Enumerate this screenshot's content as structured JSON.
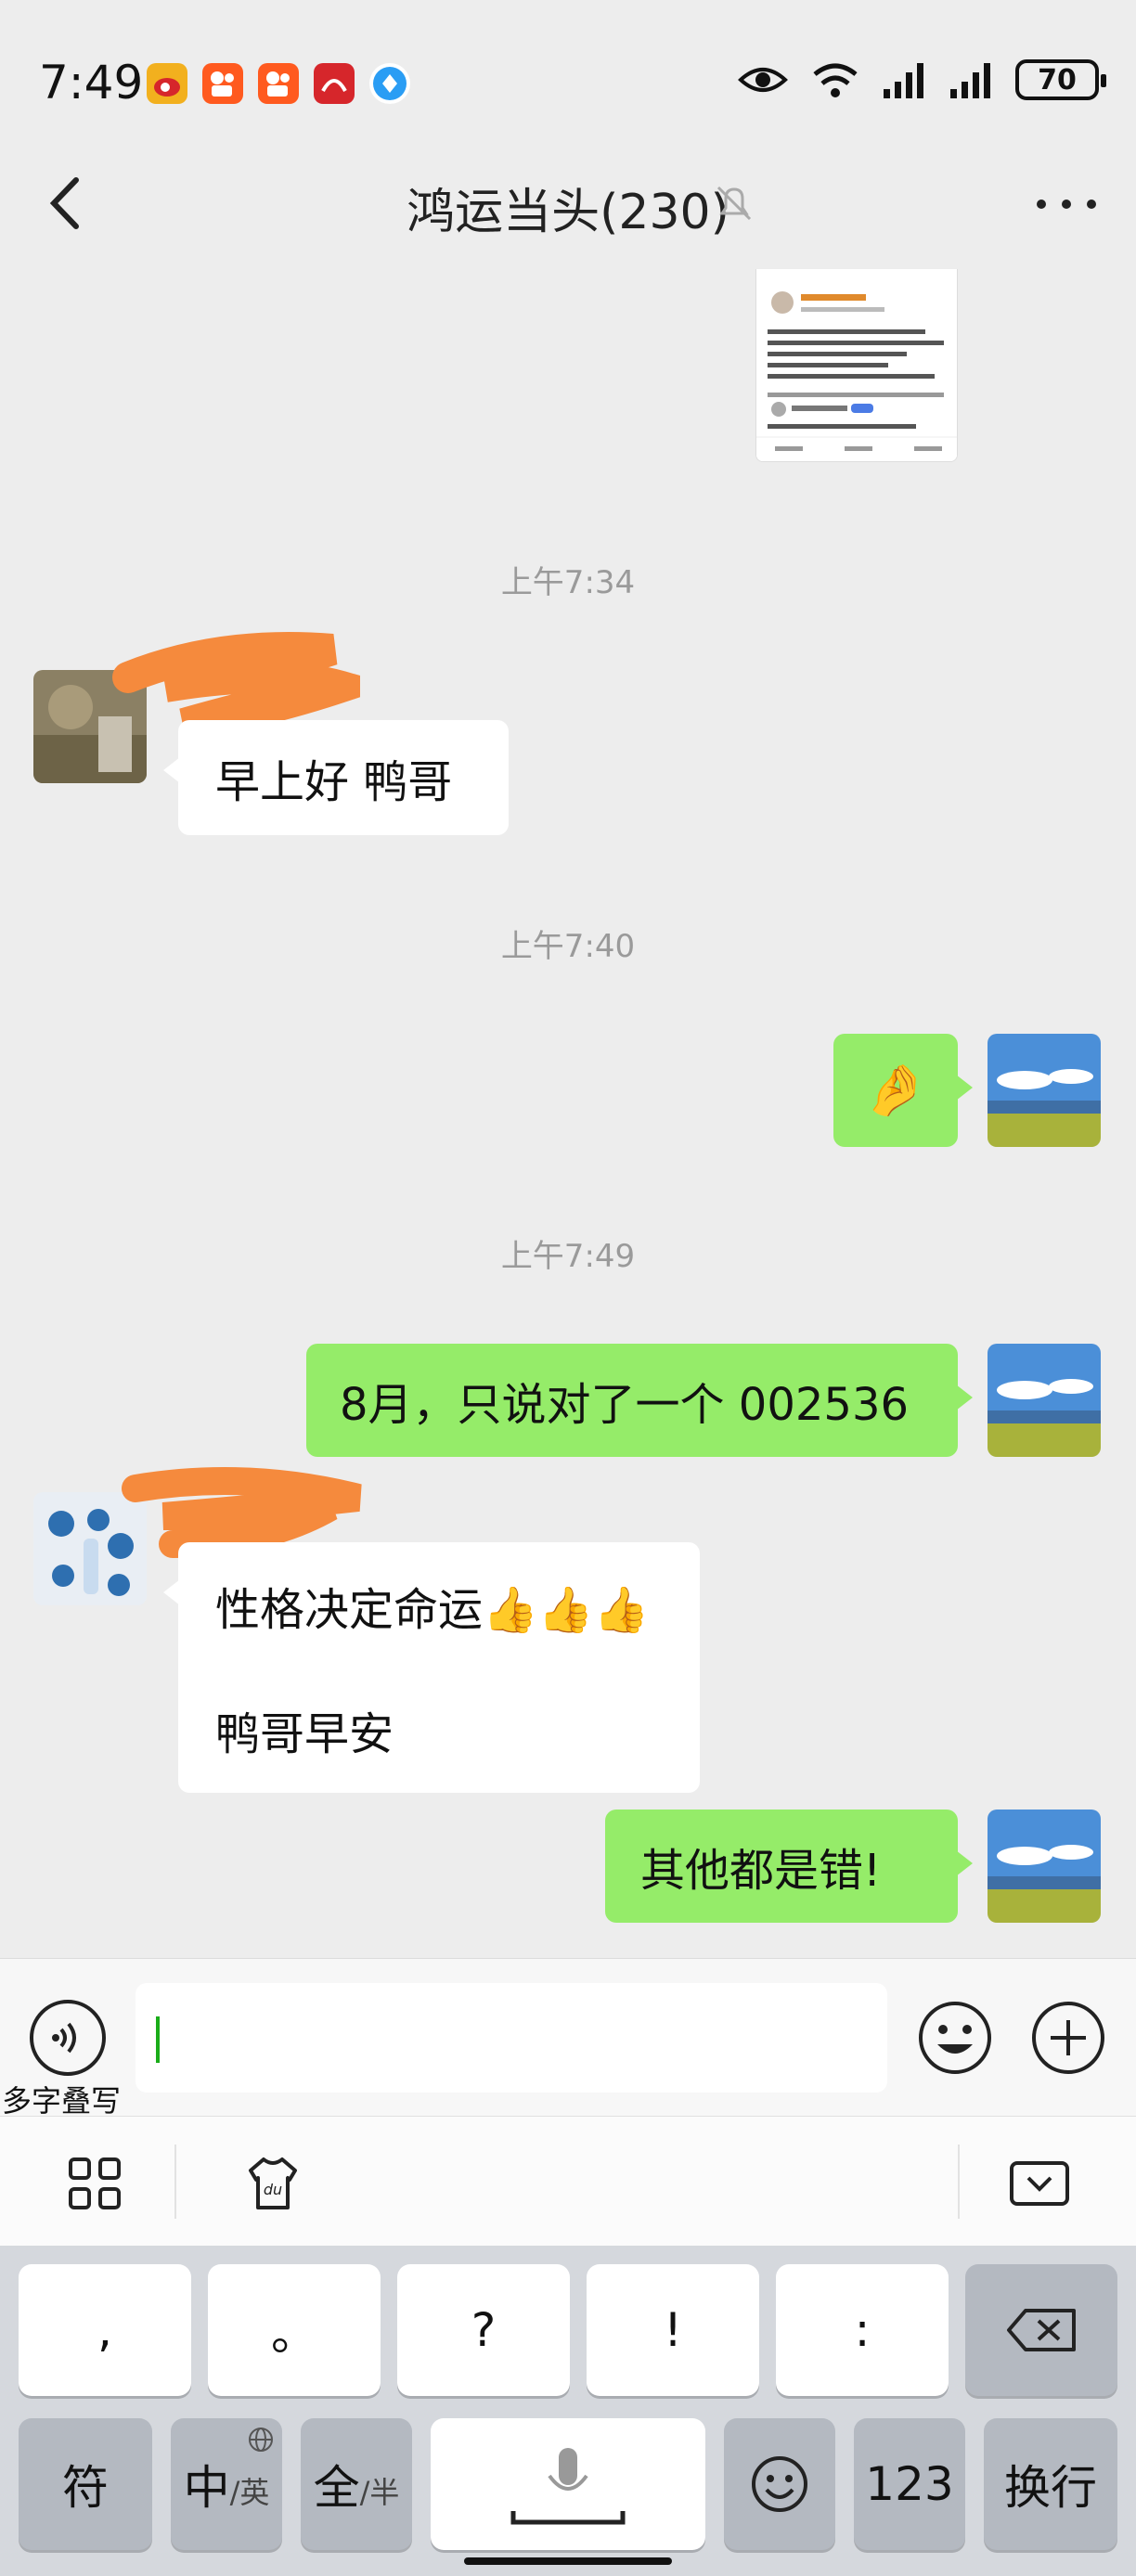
{
  "status_bar": {
    "time": "7:49",
    "battery": "70",
    "app_icons": [
      {
        "name": "weibo-icon",
        "color": "#f2b01e"
      },
      {
        "name": "kuaishou-icon",
        "color": "#ff5a1f"
      },
      {
        "name": "kuaishou-icon",
        "color": "#ff5a1f"
      },
      {
        "name": "xuexi-icon",
        "color": "#d6262b"
      },
      {
        "name": "browser-icon",
        "color": "#2a9df4"
      }
    ],
    "right_icons": [
      "eye-icon",
      "wifi-icon",
      "signal-icon",
      "signal-icon",
      "battery-icon"
    ]
  },
  "nav": {
    "title": "鸿运当头(230)",
    "back_icon": "back-arrow-icon",
    "mute_icon": "mute-bell-icon",
    "more_icon": "more-dots-icon"
  },
  "messages": {
    "time_1": "上午7:34",
    "msg_1": "早上好  鸭哥",
    "time_2": "上午7:40",
    "msg_2_emoji": "🤌",
    "time_3": "上午7:49",
    "msg_3": "8月，只说对了一个 002536",
    "msg_4_line1": "性格决定命运👍👍👍",
    "msg_4_line2": "鸭哥早安",
    "msg_5": "其他都是错!"
  },
  "input": {
    "voice_hint": "多字叠写",
    "value": ""
  },
  "keyboard": {
    "row1": [
      ",",
      "。",
      "?",
      "!",
      ":"
    ],
    "fu": "符",
    "zhong": "中",
    "zhong_sub": "/英",
    "quan": "全",
    "quan_sub": "/半",
    "num": "123",
    "enter": "换行"
  },
  "colors": {
    "accent_green": "#95ec69",
    "background": "#ededed",
    "scribble_orange": "#f58a3d"
  }
}
